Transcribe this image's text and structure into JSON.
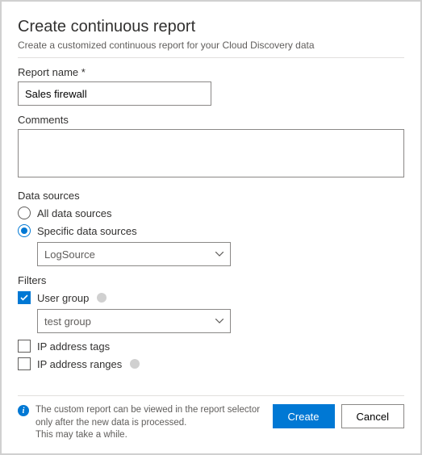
{
  "header": {
    "title": "Create continuous report",
    "subtitle": "Create a customized continuous report for your Cloud Discovery data"
  },
  "report_name": {
    "label": "Report name",
    "required_marker": "*",
    "value": "Sales firewall"
  },
  "comments": {
    "label": "Comments",
    "value": ""
  },
  "data_sources": {
    "heading": "Data sources",
    "options": {
      "all": "All data sources",
      "specific": "Specific data sources"
    },
    "selected": "specific",
    "dropdown_value": "LogSource"
  },
  "filters": {
    "heading": "Filters",
    "user_group": {
      "label": "User group",
      "checked": true,
      "dropdown_value": "test group"
    },
    "ip_tags": {
      "label": "IP address tags",
      "checked": false
    },
    "ip_ranges": {
      "label": "IP address ranges",
      "checked": false
    }
  },
  "footer": {
    "info_line1": "The custom report can be viewed in the report selector only after the new data is processed.",
    "info_line2": "This may take a while.",
    "create": "Create",
    "cancel": "Cancel"
  }
}
